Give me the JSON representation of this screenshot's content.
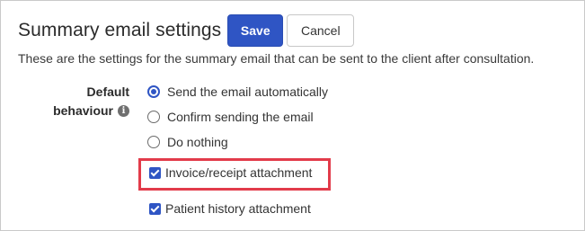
{
  "header": {
    "title": "Summary email settings",
    "save_label": "Save",
    "cancel_label": "Cancel"
  },
  "description": "These are the settings for the summary email that can be sent to the client after consultation.",
  "default_behaviour": {
    "label_line1": "Default",
    "label_line2": "behaviour",
    "info_icon": "info-icon",
    "selected": "Send the email automatically",
    "options": [
      {
        "label": "Send the email automatically",
        "checked": true
      },
      {
        "label": "Confirm sending the email",
        "checked": false
      },
      {
        "label": "Do nothing",
        "checked": false
      }
    ]
  },
  "attachments": [
    {
      "label": "Invoice/receipt attachment",
      "checked": true,
      "highlighted": true
    },
    {
      "label": "Patient history attachment",
      "checked": true,
      "highlighted": false
    }
  ],
  "colors": {
    "accent": "#2f55c4",
    "highlight": "#e23b4a"
  }
}
